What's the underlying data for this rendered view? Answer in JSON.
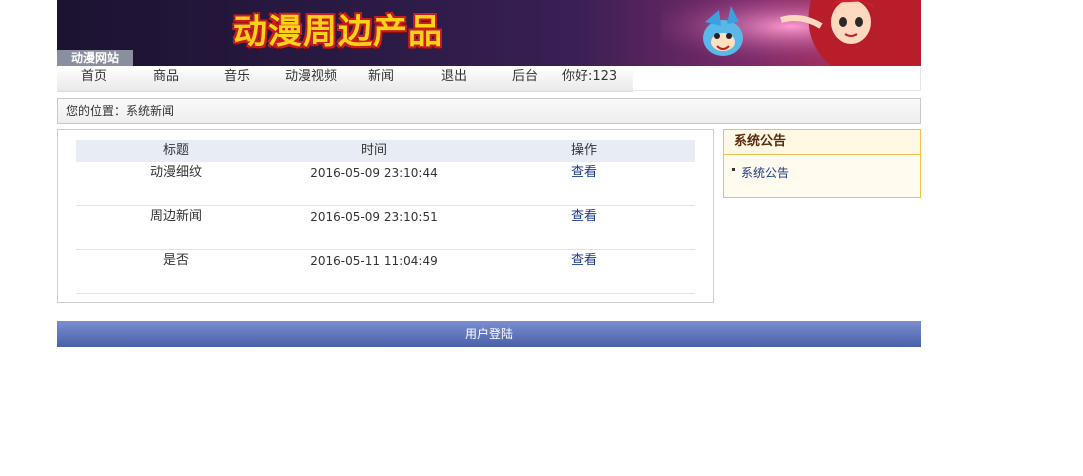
{
  "banner": {
    "title": "动漫周边产品",
    "site_name": "动漫网站",
    "colors": {
      "title_fill": "#ffd21a",
      "title_outline": "#c81d1d"
    }
  },
  "nav": {
    "items": [
      {
        "label": "首页"
      },
      {
        "label": "商品"
      },
      {
        "label": "音乐"
      },
      {
        "label": "动漫视频"
      },
      {
        "label": "新闻"
      },
      {
        "label": "退出"
      },
      {
        "label": "后台"
      }
    ],
    "greeting": "你好:123"
  },
  "breadcrumb": {
    "text": "您的位置：系统新闻"
  },
  "news_table": {
    "headers": {
      "title": "标题",
      "time": "时间",
      "action": "操作"
    },
    "rows": [
      {
        "title": "动漫细纹",
        "time": "2016-05-09 23:10:44",
        "action": "查看"
      },
      {
        "title": "周边新闻",
        "time": "2016-05-09 23:10:51",
        "action": "查看"
      },
      {
        "title": "是否",
        "time": "2016-05-11 11:04:49",
        "action": "查看"
      }
    ]
  },
  "notice": {
    "heading": "系统公告",
    "items": [
      {
        "label": "系统公告"
      }
    ]
  },
  "login_bar": {
    "label": "用户登陆"
  }
}
